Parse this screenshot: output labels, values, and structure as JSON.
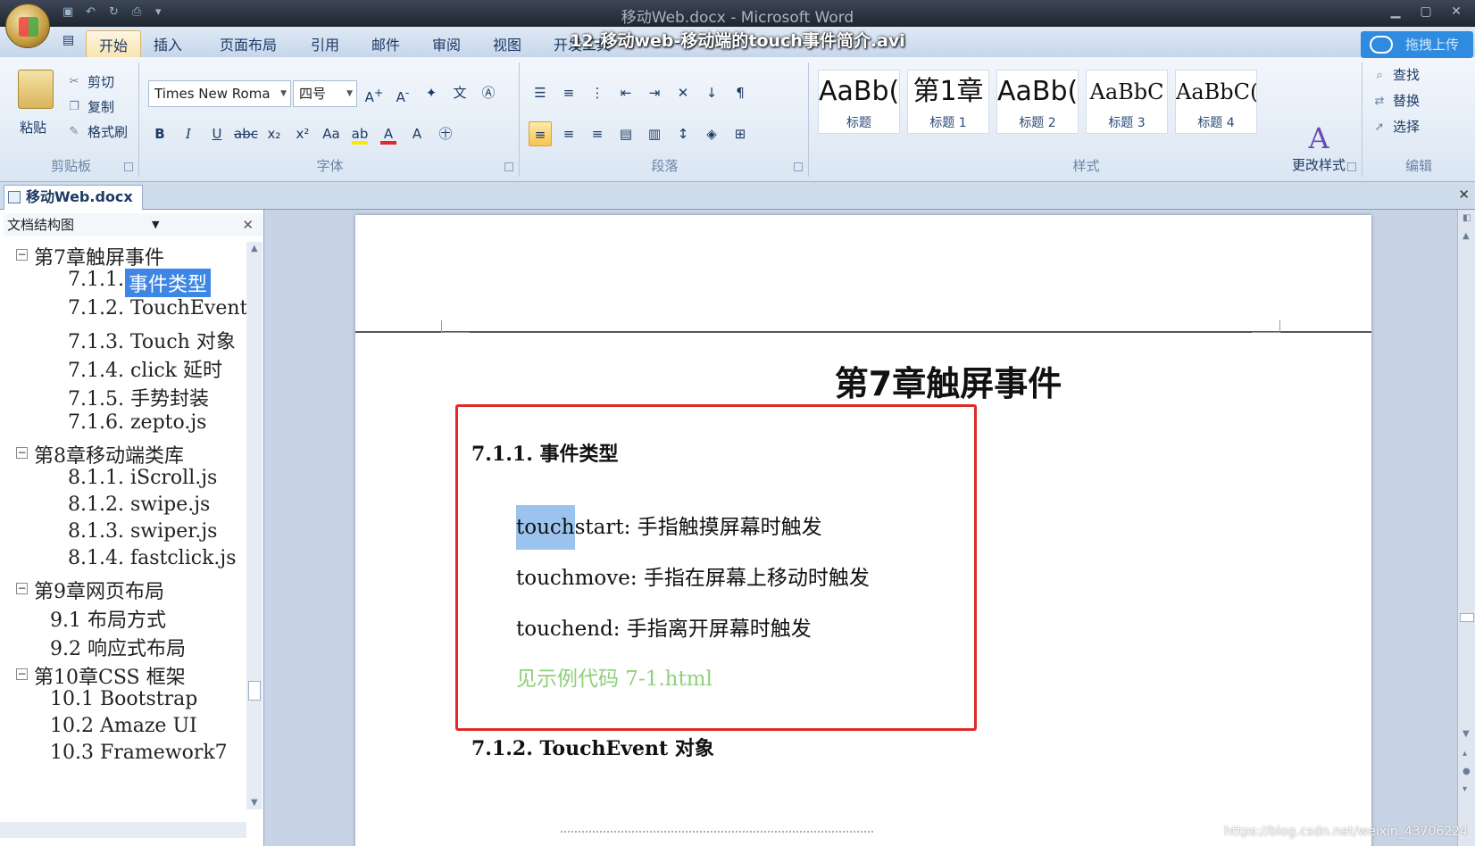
{
  "window": {
    "title": "移动Web.docx - Microsoft Word"
  },
  "video_title": "12-移动web-移动端的touch事件简介.avi",
  "ribbon_tabs": [
    "开始",
    "插入",
    "页面布局",
    "引用",
    "邮件",
    "审阅",
    "视图",
    "开发工具"
  ],
  "upload_button": "拖拽上传",
  "clipboard": {
    "paste": "粘贴",
    "cut": "剪切",
    "copy": "复制",
    "format_painter": "格式刷",
    "label": "剪贴板"
  },
  "font": {
    "name": "Times New Roma",
    "size": "四号",
    "label": "字体"
  },
  "paragraph": {
    "label": "段落"
  },
  "styles": {
    "label": "样式",
    "cards": [
      {
        "preview": "AaBb(",
        "name": "标题"
      },
      {
        "preview": "第1章",
        "name": "标题 1"
      },
      {
        "preview": "AaBb(",
        "name": "标题 2"
      },
      {
        "preview": "AaBbC",
        "name": "标题 3"
      },
      {
        "preview": "AaBbC(",
        "name": "标题 4"
      }
    ],
    "change_styles": "更改样式"
  },
  "editing": {
    "find": "查找",
    "replace": "替换",
    "select": "选择",
    "label": "编辑"
  },
  "doc_tab": "移动Web.docx",
  "doc_map": {
    "header": "文档结构图",
    "items": [
      {
        "text": "第7章触屏事件",
        "level": 0
      },
      {
        "text": "7.1.1.",
        "level": 1,
        "selected_part": "事件类型"
      },
      {
        "text": "7.1.2. TouchEvent",
        "level": 1
      },
      {
        "text": "7.1.3. Touch 对象",
        "level": 1
      },
      {
        "text": "7.1.4. click 延时",
        "level": 1
      },
      {
        "text": "7.1.5. 手势封装",
        "level": 1
      },
      {
        "text": "7.1.6. zepto.js",
        "level": 1
      },
      {
        "text": "第8章移动端类库",
        "level": 0
      },
      {
        "text": "8.1.1. iScroll.js",
        "level": 1
      },
      {
        "text": "8.1.2. swipe.js",
        "level": 1
      },
      {
        "text": "8.1.3. swiper.js",
        "level": 1
      },
      {
        "text": "8.1.4. fastclick.js",
        "level": 1
      },
      {
        "text": "第9章网页布局",
        "level": 0
      },
      {
        "text": "9.1 布局方式",
        "level": 2
      },
      {
        "text": "9.2 响应式布局",
        "level": 2
      },
      {
        "text": "第10章CSS 框架",
        "level": 0
      },
      {
        "text": "10.1 Bootstrap",
        "level": 2
      },
      {
        "text": "10.2 Amaze UI",
        "level": 2
      },
      {
        "text": "10.3 Framework7",
        "level": 2
      }
    ]
  },
  "document": {
    "chapter_title": "第7章触屏事件",
    "section1_heading": "7.1.1. 事件类型",
    "touchstart_hl": "touch",
    "touchstart_rest": "start:  手指触摸屏幕时触发",
    "touchmove": "touchmove:  手指在屏幕上移动时触发",
    "touchend": "touchend:  手指离开屏幕时触发",
    "example_link": "见示例代码 7-1.html",
    "section2_heading": "7.1.2. TouchEvent 对象"
  },
  "watermark": "https://blog.csdn.net/weixin_43706224",
  "colors": {
    "accent_red": "#e02a2a",
    "selection_blue": "#3d86e4",
    "link_green": "#8ed07a"
  }
}
